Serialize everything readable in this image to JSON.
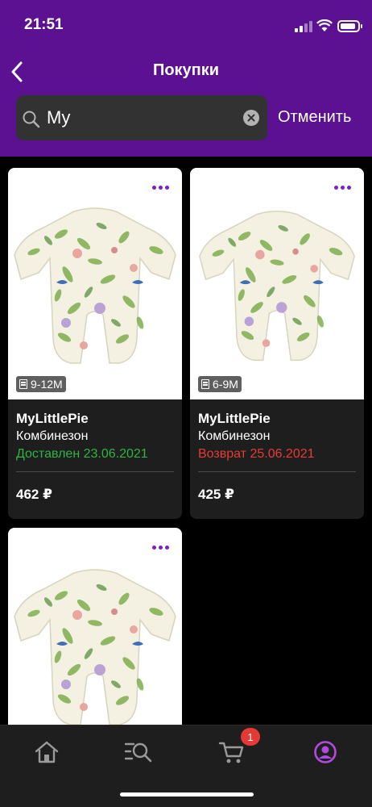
{
  "status_bar": {
    "time": "21:51"
  },
  "nav": {
    "title": "Покупки"
  },
  "search": {
    "value": "My",
    "placeholder": "",
    "cancel_label": "Отменить"
  },
  "cards": [
    {
      "size": "9-12M",
      "brand": "MyLittlePie",
      "product": "Комбинезон",
      "status": "Доставлен 23.06.2021",
      "status_color": "#2fb344",
      "price": "462 ₽"
    },
    {
      "size": "6-9M",
      "brand": "MyLittlePie",
      "product": "Комбинезон",
      "status": "Возврат 25.06.2021",
      "status_color": "#e63c35",
      "price": "425 ₽"
    },
    {
      "size": "",
      "brand": "",
      "product": "",
      "status": "",
      "price": ""
    }
  ],
  "tab_bar": {
    "items": [
      "home-icon",
      "search-list-icon",
      "cart-icon",
      "profile-icon"
    ],
    "cart_badge": "1",
    "active": "profile-icon",
    "active_color": "#b04ae0"
  },
  "colors": {
    "header": "#5b1191",
    "accent": "#7b20c6"
  }
}
